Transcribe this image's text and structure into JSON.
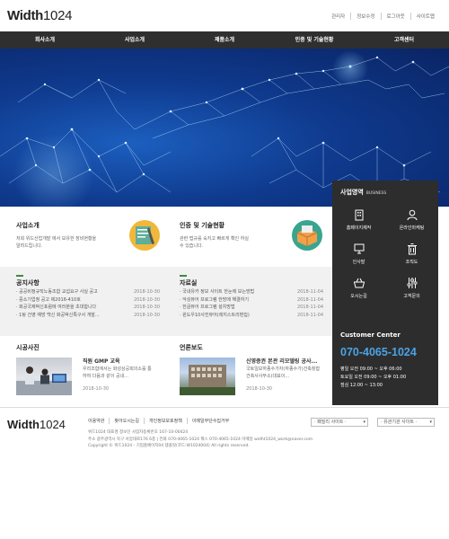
{
  "header": {
    "logo_main": "Width",
    "logo_num": "1024",
    "util_links": [
      "관리자",
      "정보수정",
      "로그아웃",
      "사이트맵"
    ]
  },
  "gnb": [
    "회사소개",
    "사업소개",
    "제품소개",
    "인증 및 기술현황",
    "고객센터"
  ],
  "business": {
    "title": "사업영역",
    "title_en": "BUSINESS",
    "items": [
      {
        "label": "홈페이지제작",
        "icon": "building-icon"
      },
      {
        "label": "온라인마케팅",
        "icon": "user-icon"
      },
      {
        "label": "인사말",
        "icon": "monitor-icon"
      },
      {
        "label": "조직도",
        "icon": "trash-icon"
      },
      {
        "label": "오시는길",
        "icon": "basket-icon"
      },
      {
        "label": "고객문의",
        "icon": "sliders-icon"
      }
    ],
    "customer_center": "Customer Center",
    "phone": "070-4065-1024",
    "hours": [
      "평일 오전 09:00 ~ 오후 06:00",
      "토요일 오전 09:00 ~ 오후 01:00",
      "점심 12:00 ~ 13:00"
    ]
  },
  "intro": {
    "business_title": "사업소개",
    "business_desc": [
      "저희 위드산업개발 에서 보유한 장비현황을",
      "알려드립니다."
    ],
    "cert_title": "인증 및 기술현황",
    "cert_desc": [
      "관련 법규를 숙지고 빠르게 확인 하실",
      "수 있습니다."
    ]
  },
  "notice": {
    "title": "공지사항",
    "items": [
      {
        "text": "· 공공비정규직노동조합 교섭요구 사실 공고",
        "date": "2018-10-30"
      },
      {
        "text": "· 중소기업청 공고 제2016-410호",
        "date": "2018-10-30"
      },
      {
        "text": "· 화공국제박신포럼에 여러분을 초대합니다",
        "date": "2018-10-30"
      },
      {
        "text": "· 1탕 건영 예방 백신 화공박신특구서 개발...",
        "date": "2018-10-30"
      }
    ]
  },
  "data_room": {
    "title": "자료실",
    "items": [
      {
        "text": "· 국내유카 정보 사이트 한눈에 보는방법",
        "date": "2018-11-04"
      },
      {
        "text": "· 악성뷰어 프로그램 한방에 해결하기",
        "date": "2018-11-04"
      },
      {
        "text": "· 한글뷰어 프로그램 설치방법",
        "date": "2018-11-04"
      },
      {
        "text": "· 윈도우10사진뷰어(레지스트리편집)",
        "date": "2018-11-04"
      }
    ]
  },
  "market_photo": {
    "title": "시공사진",
    "caption": "직원 GMP 교육",
    "text": [
      "우리조합에서는 화성상공회의소를 통",
      "하여 다음과 같이 공내..."
    ],
    "date": "2018-10-30"
  },
  "press": {
    "title": "언론보도",
    "caption": "신영증권 본관 리모델링 공사...",
    "text": [
      "국토일보하종수가자(하종수가)건축창합",
      "건축사사무소(대표이..."
    ],
    "date": "2018-10-30"
  },
  "footer": {
    "logo_main": "Width",
    "logo_num": "1024",
    "links": [
      "이용약관",
      "찾아오시는길",
      "개인정보보호정책",
      "이메일무단수집거부"
    ],
    "info": [
      "위드1024 대표명 정보인 사업자등록번호 167-10-00424",
      "주소 광주광역시 북구 서암대로176 6층 | 전화 070-4065-1024 팩스 070-4065-1024 이메일 widht1024_work@naver.com",
      "Copyright © 위드1024 - 기업홈페이지04 템플릿(코드:W1024004) All rights reserved."
    ],
    "family_site": "· 패밀리 사이트 ·",
    "related_site": "· 유관기관 사이트 ·"
  }
}
